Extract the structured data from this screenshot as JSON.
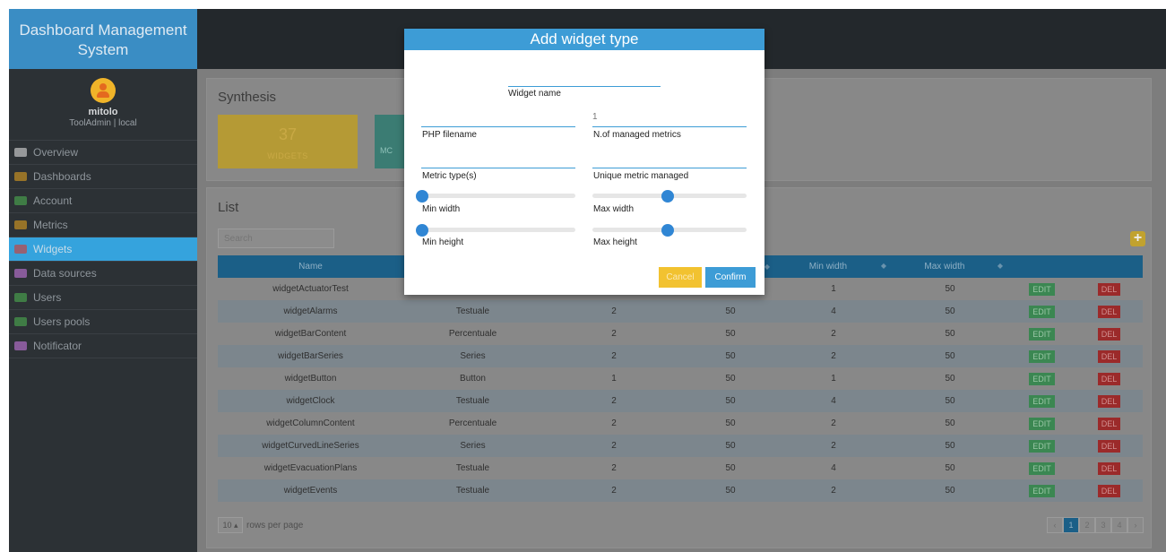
{
  "app": {
    "title": "Dashboard Management System"
  },
  "user": {
    "name": "mitolo",
    "role": "ToolAdmin | local"
  },
  "sidebar": {
    "items": [
      {
        "label": "Overview",
        "icon": "monitor-icon"
      },
      {
        "label": "Dashboards",
        "icon": "dashboard-icon"
      },
      {
        "label": "Account",
        "icon": "user-icon"
      },
      {
        "label": "Metrics",
        "icon": "metrics-icon"
      },
      {
        "label": "Widgets",
        "icon": "widgets-icon",
        "active": true
      },
      {
        "label": "Data sources",
        "icon": "database-icon"
      },
      {
        "label": "Users",
        "icon": "users-icon"
      },
      {
        "label": "Users pools",
        "icon": "pools-icon"
      },
      {
        "label": "Notificator",
        "icon": "bell-icon"
      }
    ]
  },
  "synthesis": {
    "title": "Synthesis",
    "widgets_count": "37",
    "widgets_label": "WIDGETS",
    "metrics_label_partial": "MC"
  },
  "list": {
    "title": "List",
    "search_placeholder": "Search",
    "add_label": "+",
    "columns": [
      "Name",
      "",
      "",
      "",
      "Min width",
      "Max width",
      "",
      ""
    ],
    "rows": [
      {
        "name": "widgetActuatorTest",
        "type": "",
        "metrics": "",
        "max_h": "",
        "min_w": "1",
        "max_w": "50"
      },
      {
        "name": "widgetAlarms",
        "type": "Testuale",
        "metrics": "2",
        "max_h": "50",
        "min_w": "4",
        "max_w": "50"
      },
      {
        "name": "widgetBarContent",
        "type": "Percentuale",
        "metrics": "2",
        "max_h": "50",
        "min_w": "2",
        "max_w": "50"
      },
      {
        "name": "widgetBarSeries",
        "type": "Series",
        "metrics": "2",
        "max_h": "50",
        "min_w": "2",
        "max_w": "50"
      },
      {
        "name": "widgetButton",
        "type": "Button",
        "metrics": "1",
        "max_h": "50",
        "min_w": "1",
        "max_w": "50"
      },
      {
        "name": "widgetClock",
        "type": "Testuale",
        "metrics": "2",
        "max_h": "50",
        "min_w": "4",
        "max_w": "50"
      },
      {
        "name": "widgetColumnContent",
        "type": "Percentuale",
        "metrics": "2",
        "max_h": "50",
        "min_w": "2",
        "max_w": "50"
      },
      {
        "name": "widgetCurvedLineSeries",
        "type": "Series",
        "metrics": "2",
        "max_h": "50",
        "min_w": "2",
        "max_w": "50"
      },
      {
        "name": "widgetEvacuationPlans",
        "type": "Testuale",
        "metrics": "2",
        "max_h": "50",
        "min_w": "4",
        "max_w": "50"
      },
      {
        "name": "widgetEvents",
        "type": "Testuale",
        "metrics": "2",
        "max_h": "50",
        "min_w": "2",
        "max_w": "50"
      }
    ],
    "edit_label": "EDIT",
    "del_label": "DEL",
    "rows_per_page_value": "10",
    "rows_per_page_label": "rows per page",
    "pages": [
      "‹",
      "1",
      "2",
      "3",
      "4",
      "›"
    ],
    "current_page": "1"
  },
  "modal": {
    "title": "Add widget type",
    "widget_name_label": "Widget name",
    "php_filename_label": "PHP filename",
    "managed_metrics_label": "N.of managed metrics",
    "managed_metrics_value": "1",
    "metric_types_label": "Metric type(s)",
    "unique_metric_label": "Unique metric managed",
    "min_width_label": "Min width",
    "max_width_label": "Max width",
    "min_height_label": "Min height",
    "max_height_label": "Max height",
    "cancel_label": "Cancel",
    "confirm_label": "Confirm"
  },
  "colors": {
    "accent": "#3d9cd6",
    "sidebar": "#2c3135",
    "cancel": "#f2c230",
    "edit": "#3b8752",
    "delete": "#9b2a2a"
  }
}
